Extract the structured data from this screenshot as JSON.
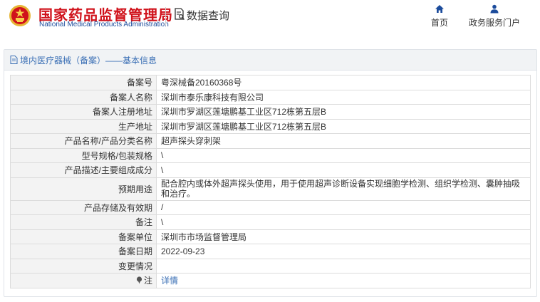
{
  "header": {
    "brand_cn": "国家药品监督管理局",
    "brand_en": "National Medical Products Administration",
    "db_title": "数据查询",
    "nav": [
      {
        "label": "首页",
        "icon": "home-icon"
      },
      {
        "label": "政务服务门户",
        "icon": "user-icon"
      }
    ],
    "brand_color": "#d0121b",
    "accent_color": "#1c4c9c"
  },
  "panel": {
    "title": "境内医疗器械（备案）——基本信息",
    "rows": [
      {
        "label": "备案号",
        "value": "粤深械备20160368号"
      },
      {
        "label": "备案人名称",
        "value": "深圳市泰乐康科技有限公司"
      },
      {
        "label": "备案人注册地址",
        "value": "深圳市罗湖区莲塘鹏基工业区712栋第五层B"
      },
      {
        "label": "生产地址",
        "value": "深圳市罗湖区莲塘鹏基工业区712栋第五层B"
      },
      {
        "label": "产品名称/产品分类名称",
        "value": "超声探头穿刺架"
      },
      {
        "label": "型号规格/包装规格",
        "value": "\\"
      },
      {
        "label": "产品描述/主要组成成分",
        "value": "\\"
      },
      {
        "label": "预期用途",
        "value": "配合腔内或体外超声探头使用，用于使用超声诊断设备实现细胞学检测、组织学检测、囊肿抽吸和治疗。"
      },
      {
        "label": "产品存储及有效期",
        "value": "/"
      },
      {
        "label": "备注",
        "value": "\\"
      },
      {
        "label": "备案单位",
        "value": "深圳市市场监督管理局"
      },
      {
        "label": "备案日期",
        "value": "2022-09-23"
      },
      {
        "label": "变更情况",
        "value": ""
      }
    ],
    "note": {
      "label": "注",
      "value": "详情"
    }
  }
}
